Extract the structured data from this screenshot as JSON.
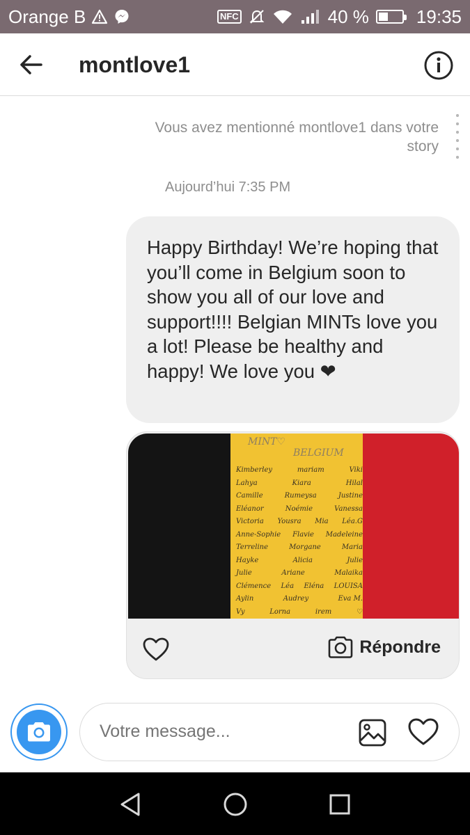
{
  "status_bar": {
    "carrier": "Orange B",
    "nfc_label": "NFC",
    "battery_percent": "40 %",
    "battery_level": 0.4,
    "time": "19:35"
  },
  "header": {
    "username": "montlove1"
  },
  "chat": {
    "mention_notice": "Vous avez mentionné montlove1 dans votre story",
    "timestamp": "Aujourd’hui 7:35 PM",
    "message_text": "Happy Birthday! We’re hoping that you’ll come in Belgium soon to show you all of our love and support!!!! Belgian MINTs love you a lot! Please be healthy and happy! We love you",
    "message_emoji": "❤"
  },
  "story_card": {
    "paper_title_1": "MINT♡",
    "paper_title_2": "BELGIUM",
    "names": [
      [
        "Kimberley",
        "mariam",
        "Viki"
      ],
      [
        "Lahya",
        "Kiara",
        "Hilal"
      ],
      [
        "Camille",
        "Rumeysa",
        "Justine"
      ],
      [
        "Eléanor",
        "Noémie",
        "Vanessa"
      ],
      [
        "Victoria",
        "Yousra",
        "Mia",
        "Léa.G"
      ],
      [
        "Anne-Sophie",
        "Flavie",
        "Madeleine"
      ],
      [
        "Terreline",
        "Morgane",
        "Maria"
      ],
      [
        "Hayke",
        "Alicia",
        "Julie"
      ],
      [
        "Julie",
        "Ariane",
        "Malaika"
      ],
      [
        "Clémence",
        "Léa",
        "Eléna",
        "LOUISA"
      ],
      [
        "Aylin",
        "Audrey",
        "Eva M."
      ],
      [
        "Vy",
        "Lorna",
        "irem",
        "♡"
      ]
    ],
    "reply_label": "Répondre"
  },
  "composer": {
    "placeholder": "Votre message..."
  },
  "colors": {
    "accent": "#3897f0",
    "bubble": "#efefef",
    "status_bar": "#7a6a70"
  }
}
